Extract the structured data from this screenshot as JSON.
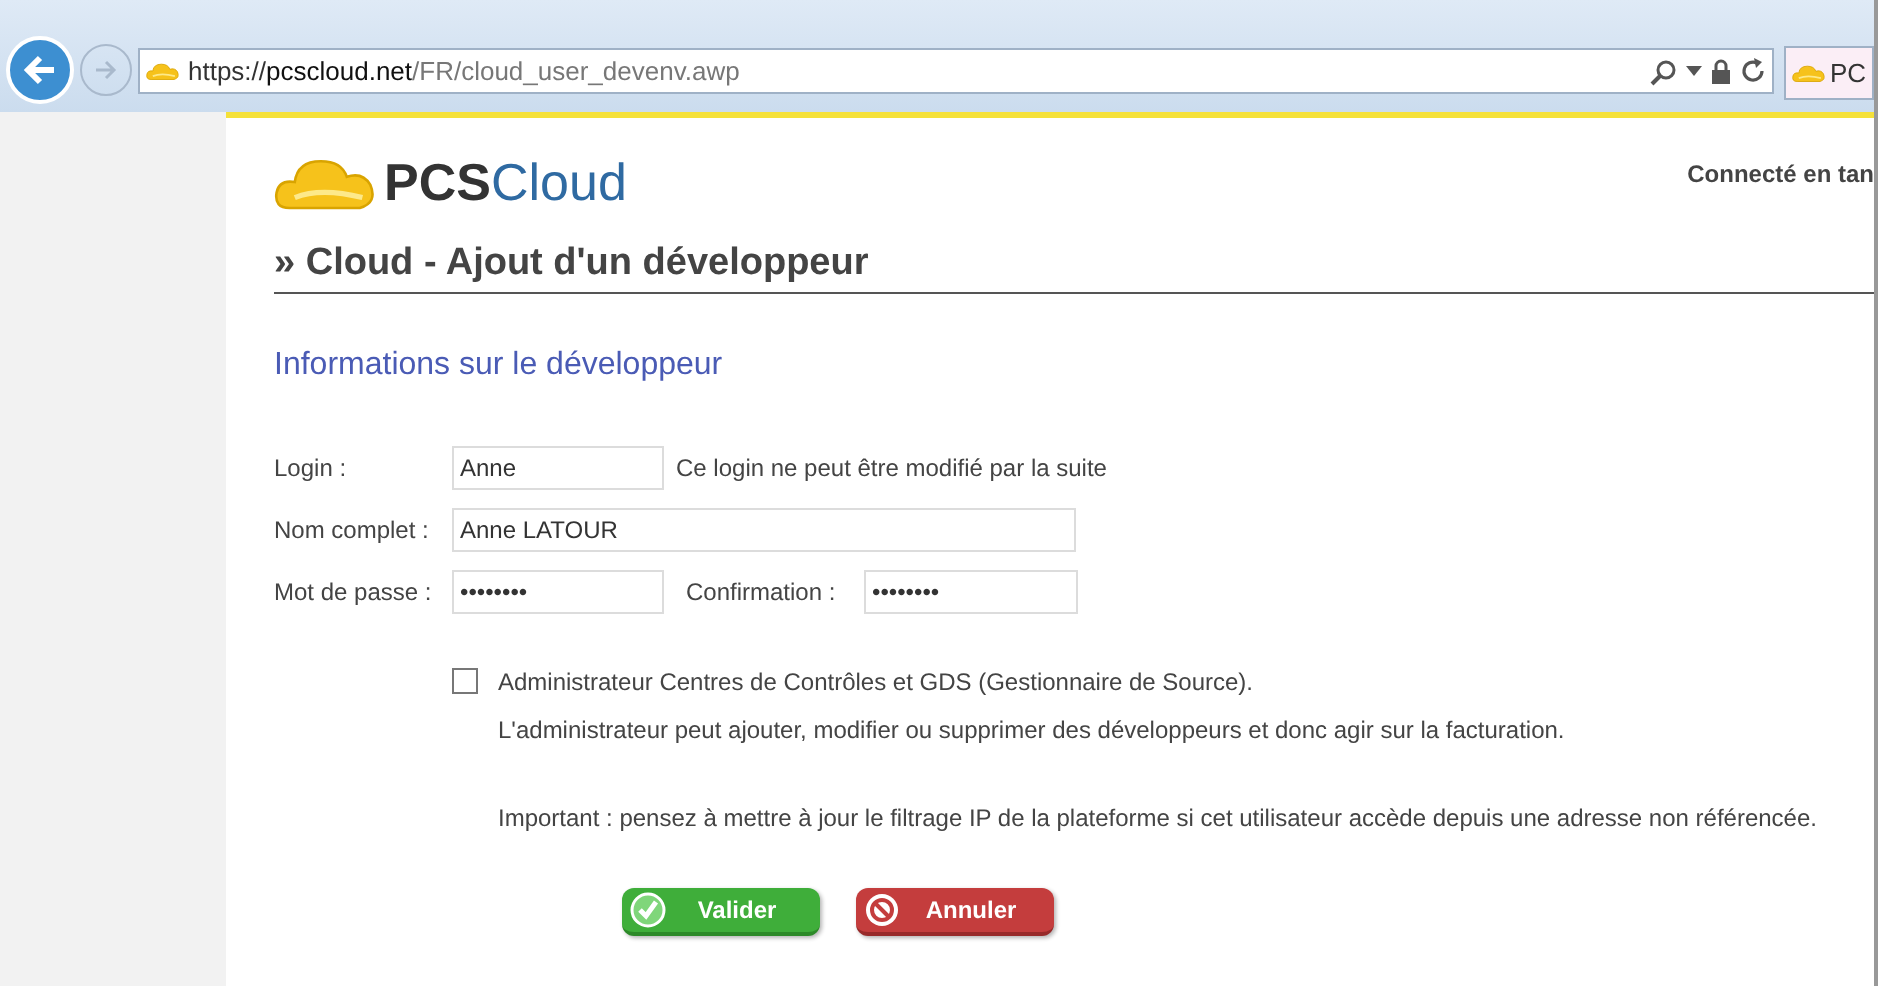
{
  "browser": {
    "url_scheme": "https://",
    "url_host": "pcscloud.net",
    "url_path": "/FR/cloud_user_devenv.awp",
    "tab_title": "PC"
  },
  "header": {
    "logo_prefix": "PCS",
    "logo_suffix": "Cloud",
    "connection_status": "Connecté en tan"
  },
  "page_title": "» Cloud - Ajout d'un développeur",
  "section_title": "Informations sur le développeur",
  "form": {
    "login": {
      "label": "Login :",
      "value": "Anne",
      "note": "Ce login ne peut être modifié par la suite"
    },
    "full_name": {
      "label": "Nom complet :",
      "value": "Anne LATOUR"
    },
    "password": {
      "label": "Mot de passe :",
      "value": "••••••••"
    },
    "confirmation": {
      "label": "Confirmation :",
      "value": "••••••••"
    },
    "admin": {
      "checked": false,
      "label": "Administrateur Centres de Contrôles et GDS (Gestionnaire de Source).",
      "description": "L'administrateur peut ajouter, modifier ou supprimer des développeurs et donc agir sur la facturation."
    },
    "notice": "Important : pensez à mettre à jour le filtrage IP de la plateforme si cet utilisateur accède depuis une adresse non référencée."
  },
  "buttons": [
    {
      "kind": "confirm",
      "label": "Valider"
    },
    {
      "kind": "cancel",
      "label": "Annuler"
    }
  ]
}
